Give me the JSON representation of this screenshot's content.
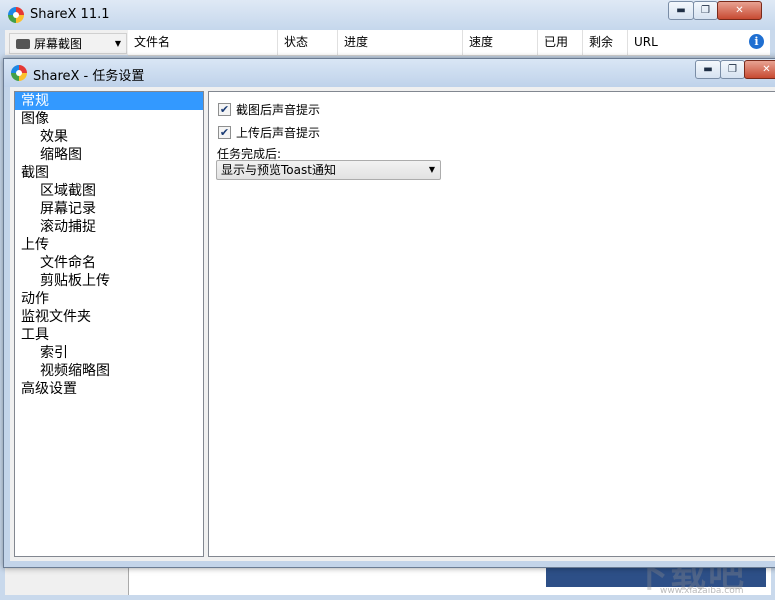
{
  "main_window": {
    "title": "ShareX 11.1",
    "capture_button": "屏幕截图",
    "columns": [
      "文件名",
      "状态",
      "进度",
      "速度",
      "已用",
      "剩余",
      "URL"
    ],
    "caption_icons": [
      "minimize-icon",
      "maximize-icon",
      "close-icon"
    ]
  },
  "dialog": {
    "title": "ShareX - 任务设置",
    "nav": [
      {
        "label": "常规",
        "level": 0,
        "selected": true
      },
      {
        "label": "图像",
        "level": 0
      },
      {
        "label": "效果",
        "level": 1
      },
      {
        "label": "缩略图",
        "level": 1
      },
      {
        "label": "截图",
        "level": 0
      },
      {
        "label": "区域截图",
        "level": 1
      },
      {
        "label": "屏幕记录",
        "level": 1
      },
      {
        "label": "滚动捕捉",
        "level": 1
      },
      {
        "label": "上传",
        "level": 0
      },
      {
        "label": "文件命名",
        "level": 1
      },
      {
        "label": "剪贴板上传",
        "level": 1
      },
      {
        "label": "动作",
        "level": 0
      },
      {
        "label": "监视文件夹",
        "level": 0
      },
      {
        "label": "工具",
        "level": 0
      },
      {
        "label": "索引",
        "level": 1
      },
      {
        "label": "视频缩略图",
        "level": 1
      },
      {
        "label": "高级设置",
        "level": 0
      }
    ],
    "general": {
      "checkbox_sound_after_capture": {
        "label": "截图后声音提示",
        "checked": true
      },
      "checkbox_sound_after_upload": {
        "label": "上传后声音提示",
        "checked": true
      },
      "after_task_label": "任务完成后:",
      "after_task_value": "显示与预览Toast通知"
    }
  },
  "colors": {
    "selection": "#3399ff",
    "title_bar": "#c5d7ec",
    "window_bg": "#f0f0f0"
  }
}
